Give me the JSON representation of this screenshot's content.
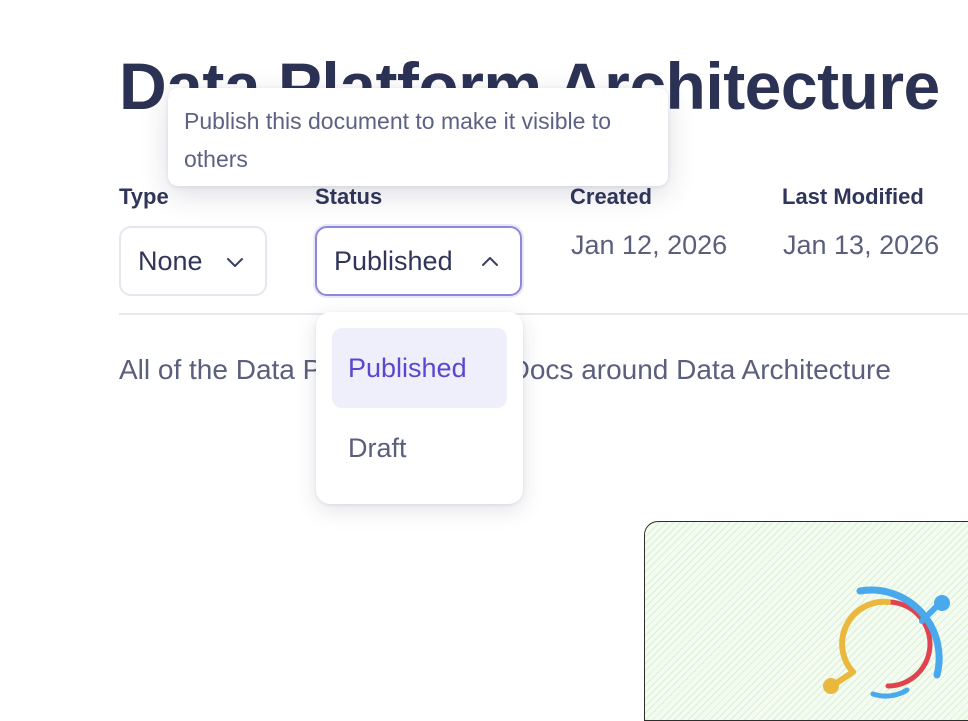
{
  "page": {
    "title": "Data Platform Architecture",
    "description": "All of the Data Platform Design Docs around Data Architecture"
  },
  "tooltip": {
    "text": "Publish this document to make it visible to others"
  },
  "properties": {
    "type": {
      "label": "Type",
      "value": "None",
      "icon": "chevron-down-icon"
    },
    "status": {
      "label": "Status",
      "value": "Published",
      "icon": "chevron-up-icon",
      "options": [
        "Published",
        "Draft"
      ],
      "selected": "Published"
    },
    "created": {
      "label": "Created",
      "value": "Jan 12, 2026"
    },
    "last_modified": {
      "label": "Last Modified",
      "value": "Jan 13, 2026"
    }
  },
  "colors": {
    "title": "#2c3254",
    "accent": "#5a47cf",
    "selected_option_bg": "#efeefb",
    "focus_border": "#8e88d8"
  }
}
